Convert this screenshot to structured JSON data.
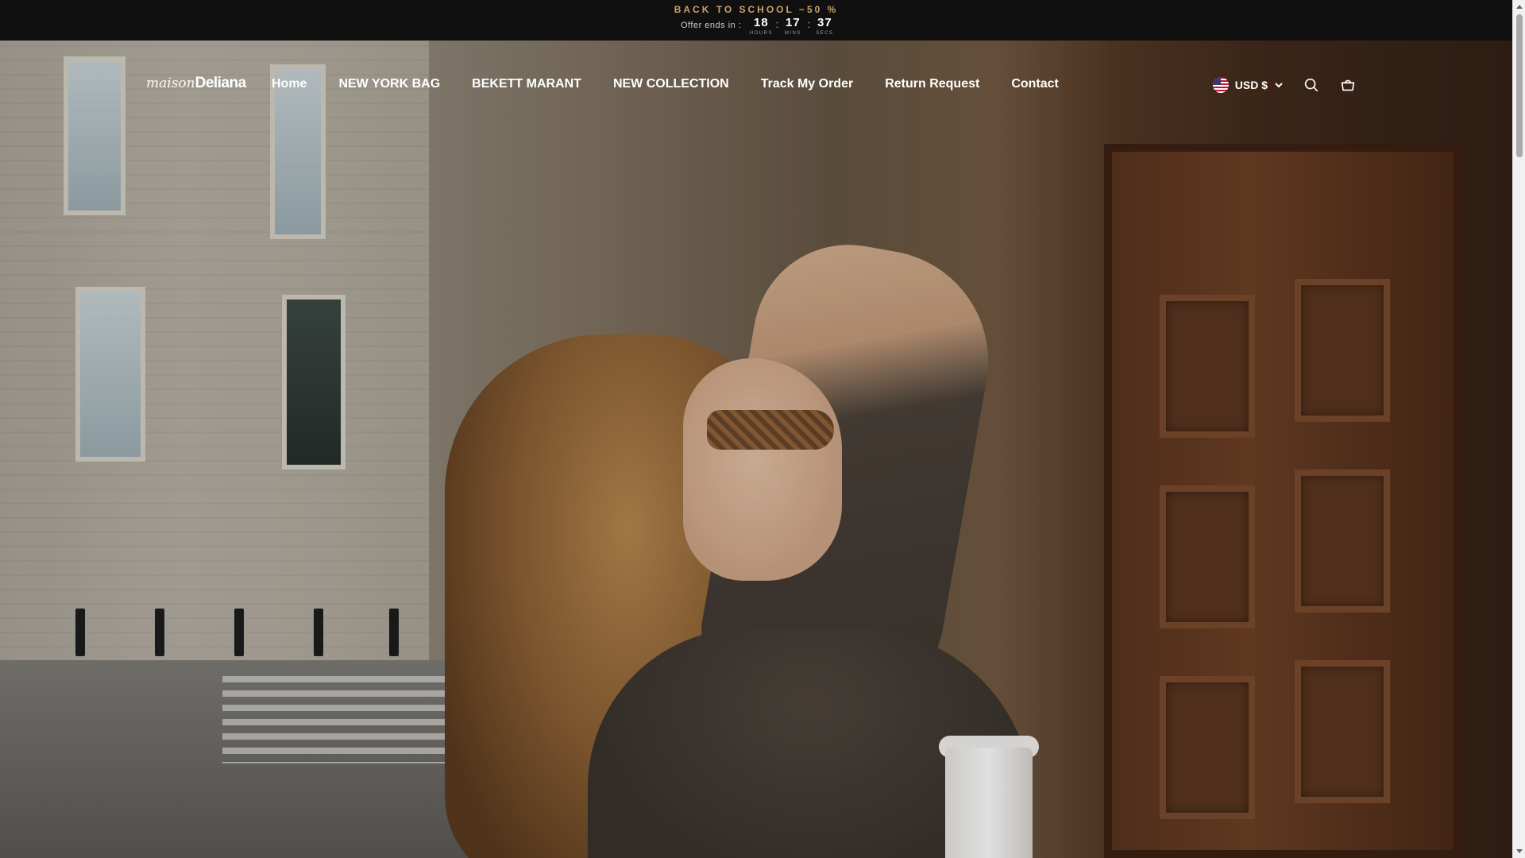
{
  "announcement": {
    "title": "BACK TO SCHOOL −50 %",
    "offer_label": "Offer ends in :",
    "countdown": [
      {
        "value": "18",
        "caption": "HOURS"
      },
      {
        "value": "17",
        "caption": "MINS"
      },
      {
        "value": "37",
        "caption": "SECS"
      }
    ],
    "separator": ":"
  },
  "header": {
    "logo_italic": "maison",
    "logo_bold": "Deliana",
    "nav": [
      "Home",
      "NEW YORK BAG",
      "BEKETT MARANT",
      "NEW COLLECTION",
      "Track My Order",
      "Return Request",
      "Contact"
    ],
    "currency": "USD $",
    "icons": [
      "us-flag-icon",
      "chevron-down-icon",
      "search-icon",
      "cart-icon"
    ]
  },
  "colors": {
    "announcement_bg": "#101010",
    "announcement_accent": "#c9a26a",
    "nav_text": "#ffffff"
  }
}
